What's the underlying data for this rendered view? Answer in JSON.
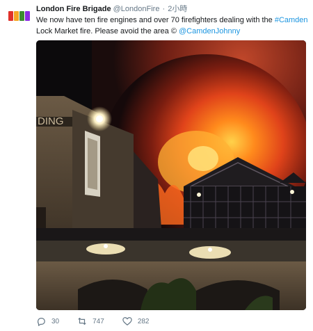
{
  "tweet": {
    "author_name": "London Fire Brigade",
    "handle": "@LondonFire",
    "separator": "·",
    "time": "2小時",
    "text_part1": "We now have ten fire engines and over 70 firefighters dealing with the ",
    "hashtag": "#Camden",
    "text_part2": " Lock Market fire. Please avoid the area  © ",
    "mention": "@CamdenJohnny"
  },
  "media": {
    "sign_text": "DING"
  },
  "actions": {
    "reply_count": "30",
    "retweet_count": "747",
    "like_count": "282"
  },
  "colors": {
    "link": "#1b95e0",
    "secondary_text": "#657786",
    "fire": "#ff5a1a"
  }
}
